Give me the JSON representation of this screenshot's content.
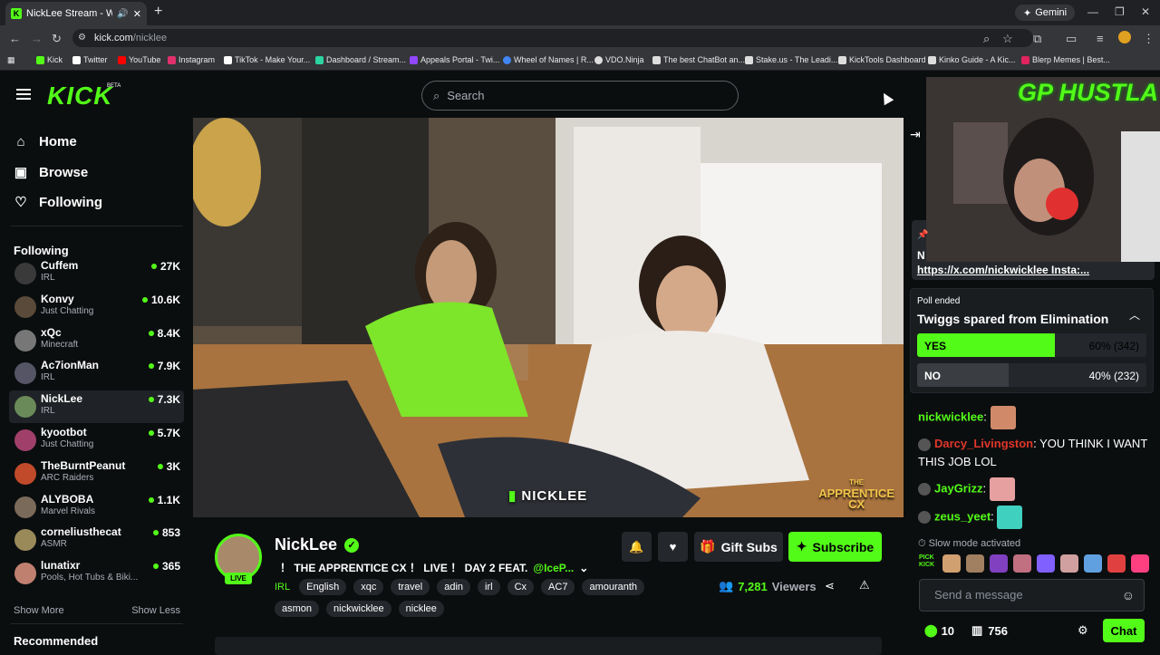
{
  "browser": {
    "tab_title": "NickLee Stream - Watch Li",
    "gemini_label": "Gemini",
    "url_host": "kick.com",
    "url_path": "/nicklee",
    "bookmarks": [
      {
        "label": "Kick",
        "color": "#53fc18"
      },
      {
        "label": "Twitter",
        "color": "#ffffff"
      },
      {
        "label": "YouTube",
        "color": "#ff0000"
      },
      {
        "label": "Instagram",
        "color": "#e1306c"
      },
      {
        "label": "TikTok - Make Your...",
        "color": "#ffffff"
      },
      {
        "label": "Dashboard / Stream...",
        "color": "#2bd4a0"
      },
      {
        "label": "Appeals Portal - Twi...",
        "color": "#9146ff"
      },
      {
        "label": "Wheel of Names | R...",
        "color": "#4285f4"
      },
      {
        "label": "VDO.Ninja",
        "color": "#dddddd"
      },
      {
        "label": "The best ChatBot an...",
        "color": "#dddddd"
      },
      {
        "label": "Stake.us - The Leadi...",
        "color": "#dddddd"
      },
      {
        "label": "KickTools Dashboard",
        "color": "#dddddd"
      },
      {
        "label": "Kinko Guide - A Kic...",
        "color": "#dddddd"
      },
      {
        "label": "Blerp Memes | Best...",
        "color": "#e0245e"
      }
    ]
  },
  "header": {
    "logo": "KICK",
    "beta": "BETA",
    "search_placeholder": "Search"
  },
  "sidebar": {
    "nav": [
      {
        "label": "Home",
        "icon": "home-icon"
      },
      {
        "label": "Browse",
        "icon": "browse-icon"
      },
      {
        "label": "Following",
        "icon": "heart-icon"
      }
    ],
    "following_heading": "Following",
    "following": [
      {
        "name": "Cuffem",
        "category": "IRL",
        "viewers": "27K",
        "color": "#3a3a3a"
      },
      {
        "name": "Konvy",
        "category": "Just Chatting",
        "viewers": "10.6K",
        "color": "#5a4a3a"
      },
      {
        "name": "xQc",
        "category": "Minecraft",
        "viewers": "8.4K",
        "color": "#777777"
      },
      {
        "name": "Ac7ionMan",
        "category": "IRL",
        "viewers": "7.9K",
        "color": "#555566"
      },
      {
        "name": "NickLee",
        "category": "IRL",
        "viewers": "7.3K",
        "color": "#6b8a5a"
      },
      {
        "name": "kyootbot",
        "category": "Just Chatting",
        "viewers": "5.7K",
        "color": "#a0406a"
      },
      {
        "name": "TheBurntPeanut",
        "category": "ARC Raiders",
        "viewers": "3K",
        "color": "#c04a2a"
      },
      {
        "name": "ALYBOBA",
        "category": "Marvel Rivals",
        "viewers": "1.1K",
        "color": "#7a6a5a"
      },
      {
        "name": "corneliusthecat",
        "category": "ASMR",
        "viewers": "853",
        "color": "#9a8a5a"
      },
      {
        "name": "lunatixr",
        "category": "Pools, Hot Tubs & Biki...",
        "viewers": "365",
        "color": "#c08070"
      }
    ],
    "show_more": "Show More",
    "show_less": "Show Less",
    "recommended_heading": "Recommended"
  },
  "stream": {
    "watermark": "NICKLEE",
    "overlay_logo_line1": "THE",
    "overlay_logo_line2": "APPRENTICE",
    "overlay_logo_line3": "CX",
    "channel_name": "NickLee",
    "live_badge": "LIVE",
    "title": "！ THE APPRENTICE CX ！ LIVE ！ DAY 2 FEAT.",
    "title_mention": "@IceP...",
    "category": "IRL",
    "tags": [
      "English",
      "xqc",
      "travel",
      "adin",
      "irl",
      "Cx",
      "AC7",
      "amouranth",
      "asmon",
      "nickwicklee",
      "nicklee"
    ],
    "gift_subs_label": "Gift Subs",
    "subscribe_label": "Subscribe",
    "viewer_count": "7,281",
    "viewers_label": "Viewers"
  },
  "chat": {
    "cam_title": "GP HUSTLA",
    "pinned_initial": "N",
    "pinned_link": "https://x.com/nickwicklee Insta:...",
    "poll": {
      "status": "Poll ended",
      "question": "Twiggs spared from Elimination",
      "options": [
        {
          "label": "YES",
          "result": "60% (342)",
          "fraction": 0.6,
          "color": "#53fc18"
        },
        {
          "label": "NO",
          "result": "40% (232)",
          "fraction": 0.4,
          "color": "#3a3d42"
        }
      ]
    },
    "messages": [
      {
        "user": "nickwicklee",
        "text": "",
        "color": "#53fc18",
        "emote_color": "#d08a6a"
      },
      {
        "user": "Darcy_Livingston",
        "text": "YOU THINK I WANT THIS JOB LOL",
        "color": "#e0362a",
        "emote_color": ""
      },
      {
        "user": "JayGrizz",
        "text": "",
        "color": "#53fc18",
        "emote_color": "#e6a0a0"
      },
      {
        "user": "zeus_yeet",
        "text": "",
        "color": "#53fc18",
        "emote_color": "#3fd0c0"
      }
    ],
    "slow_mode": "Slow mode activated",
    "emote_pack_label": "PICK KICK",
    "emote_colors": [
      "#d0a070",
      "#a08060",
      "#8040c0",
      "#c07080",
      "#8060ff",
      "#d0a0a0",
      "#60a0e0",
      "#e04040",
      "#ff4080"
    ],
    "input_placeholder": "Send a message",
    "points": "10",
    "store_count": "756",
    "chat_button": "Chat"
  }
}
